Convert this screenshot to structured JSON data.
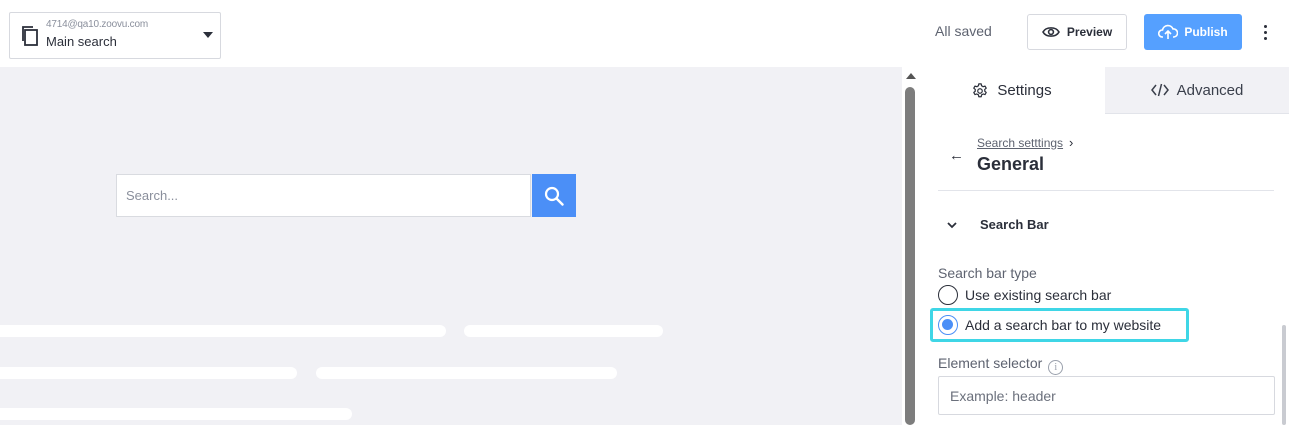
{
  "header": {
    "project_email": "4714@qa10.zoovu.com",
    "project_name": "Main search",
    "save_status": "All saved",
    "preview_label": "Preview",
    "publish_label": "Publish"
  },
  "preview": {
    "search_placeholder": "Search..."
  },
  "panel": {
    "tabs": [
      {
        "label": "Settings",
        "icon": "gear-icon",
        "active": true
      },
      {
        "label": "Advanced",
        "icon": "code-icon",
        "active": false
      }
    ],
    "breadcrumb": "Search setttings",
    "title": "General",
    "section": "Search Bar",
    "search_bar_type_label": "Search bar type",
    "options": [
      {
        "label": "Use existing search bar",
        "selected": false
      },
      {
        "label": "Add a search bar to my website",
        "selected": true
      }
    ],
    "element_selector_label": "Element selector",
    "element_selector_placeholder": "Example: header"
  },
  "colors": {
    "accent": "#4b8ff7",
    "publish": "#55a0ff",
    "focus": "#3fd6e6",
    "preview_bg": "#f1f1f5"
  }
}
